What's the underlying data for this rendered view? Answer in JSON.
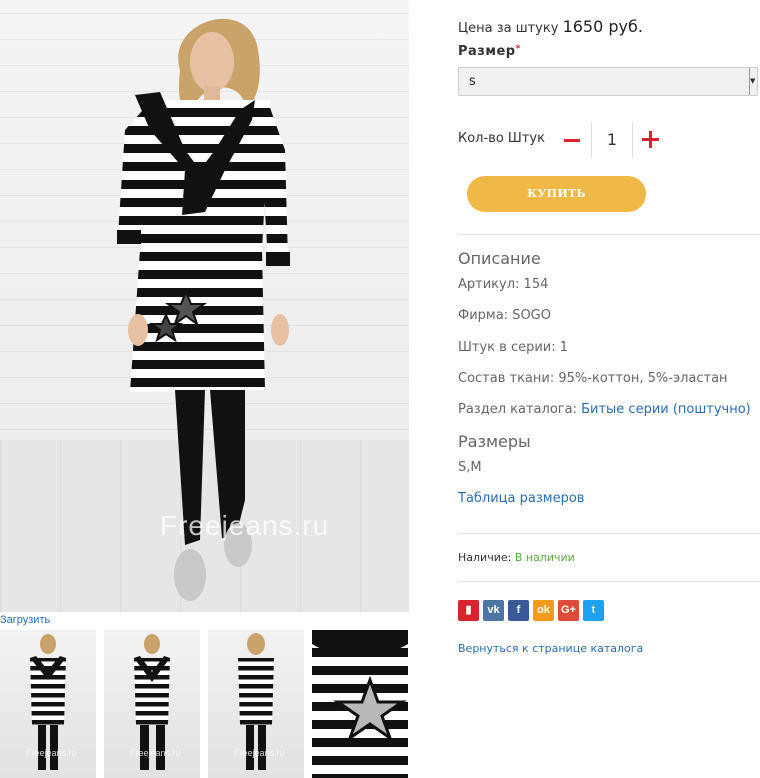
{
  "gallery": {
    "watermark": "Freejeans.ru",
    "load_link": "Загрузить",
    "thumb_watermark": "Freejeans.ru"
  },
  "product": {
    "price_label": "Цена за штуку",
    "price_value": "1650 руб.",
    "size_label": "Размер",
    "size_required_mark": "*",
    "size_selected": "s",
    "qty_label": "Кол-во Штук",
    "qty_value": "1",
    "buy_label": "КУПИТЬ"
  },
  "description": {
    "title": "Описание",
    "article_label": "Артикул:",
    "article_value": "154",
    "brand_label": "Фирма:",
    "brand_value": "SOGO",
    "series_label": "Штук в серии:",
    "series_value": "1",
    "fabric_label": "Состав ткани:",
    "fabric_value": "95%-коттон, 5%-эластан",
    "section_label": "Раздел каталога:",
    "section_value": "Битые серии (поштучно)"
  },
  "sizes": {
    "title": "Размеры",
    "values": "S,M",
    "table_link": "Таблица размеров"
  },
  "availability": {
    "label": "Наличие:",
    "value": "В наличии"
  },
  "share": [
    {
      "name": "bookmark-icon",
      "glyph": "▮",
      "color": "#d9232d"
    },
    {
      "name": "vk-icon",
      "glyph": "vk",
      "color": "#4c75a3"
    },
    {
      "name": "facebook-icon",
      "glyph": "f",
      "color": "#3b5998"
    },
    {
      "name": "odnoklassniki-icon",
      "glyph": "ok",
      "color": "#f59a1c"
    },
    {
      "name": "google-plus-icon",
      "glyph": "G+",
      "color": "#dd4b39"
    },
    {
      "name": "twitter-icon",
      "glyph": "t",
      "color": "#1da1f2"
    }
  ],
  "back_link": "Вернуться к странице каталога",
  "colors": {
    "accent_button": "#efb847",
    "qty_controls": "#d9232d",
    "link": "#2a6db3",
    "in_stock": "#5aa844"
  }
}
